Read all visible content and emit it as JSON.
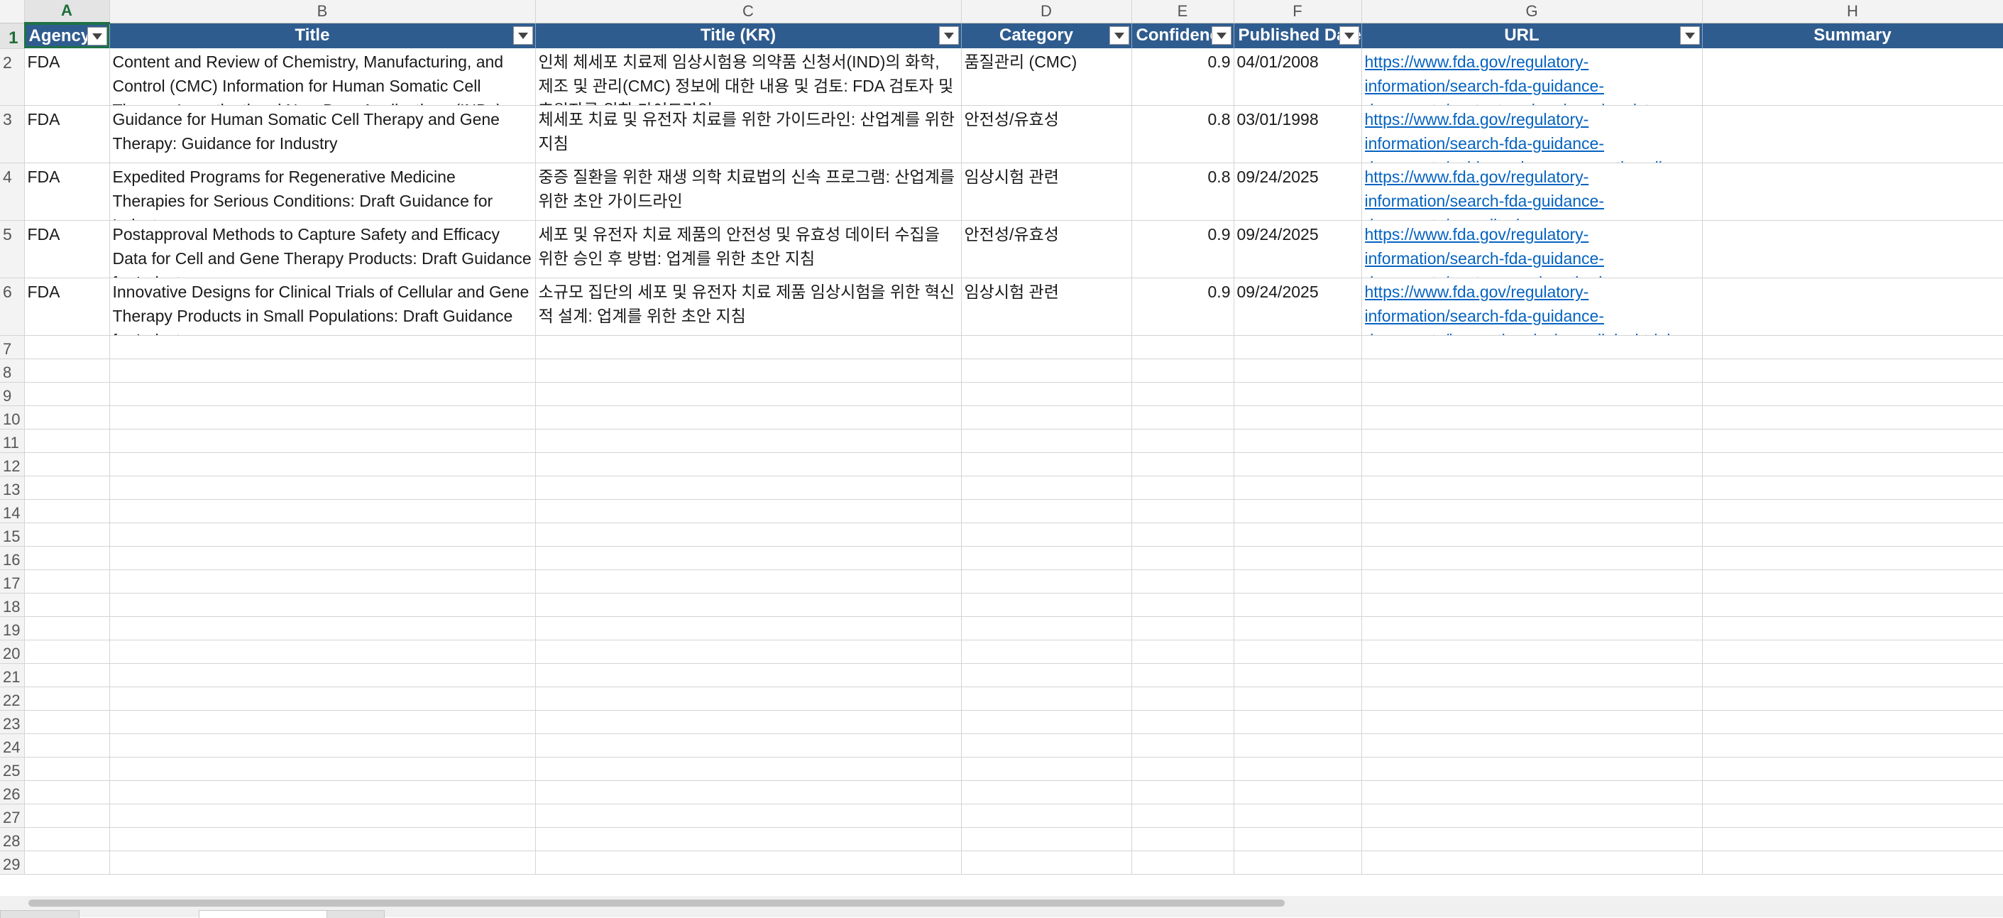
{
  "columns": [
    "A",
    "B",
    "C",
    "D",
    "E",
    "F",
    "G",
    "H"
  ],
  "headers": [
    "Agency",
    "Title",
    "Title (KR)",
    "Category",
    "Confidence",
    "Published Date",
    "URL",
    "Summary"
  ],
  "header_has_filter": [
    true,
    true,
    true,
    true,
    true,
    true,
    true,
    false
  ],
  "rows": [
    {
      "num": "2",
      "agency": "FDA",
      "title": "Content and Review of Chemistry, Manufacturing, and Control (CMC) Information for Human Somatic Cell Therapy Investigational New Drug Applications (INDs)",
      "title_kr": "인체 체세포 치료제 임상시험용 의약품 신청서(IND)의 화학, 제조 및 관리(CMC) 정보에 대한 내용 및 검토: FDA 검토자 및 후원자를 위한 가이드라인",
      "category": "품질관리 (CMC)",
      "confidence": "0.9",
      "date": "04/01/2008",
      "url": "https://www.fda.gov/regulatory-information/search-fda-guidance-documents/content-and-review-chemistry",
      "summary": ""
    },
    {
      "num": "3",
      "agency": "FDA",
      "title": "Guidance for Human Somatic Cell Therapy and Gene Therapy:  Guidance for Industry",
      "title_kr": "체세포 치료 및 유전자 치료를 위한 가이드라인: 산업계를 위한 지침",
      "category": "안전성/유효성",
      "confidence": "0.8",
      "date": "03/01/1998",
      "url": "https://www.fda.gov/regulatory-information/search-fda-guidance-documents/guidance-human-somatic-cell",
      "summary": ""
    },
    {
      "num": "4",
      "agency": "FDA",
      "title": "Expedited Programs for Regenerative Medicine Therapies for Serious Conditions: Draft Guidance for Industry",
      "title_kr": "중증 질환을 위한 재생 의학 치료법의 신속 프로그램: 산업계를 위한 초안 가이드라인",
      "category": "임상시험 관련",
      "confidence": "0.8",
      "date": "09/24/2025",
      "url": "https://www.fda.gov/regulatory-information/search-fda-guidance-documents/expedited-programs",
      "summary": ""
    },
    {
      "num": "5",
      "agency": "FDA",
      "title": "Postapproval Methods to Capture Safety and Efficacy Data for Cell and Gene Therapy Products: Draft Guidance for Industry",
      "title_kr": "세포 및 유전자 치료 제품의 안전성 및 유효성 데이터 수집을 위한 승인 후 방법: 업계를 위한 초안 지침",
      "category": "안전성/유효성",
      "confidence": "0.9",
      "date": "09/24/2025",
      "url": "https://www.fda.gov/regulatory-information/search-fda-guidance-documents/postapproval-methods",
      "summary": ""
    },
    {
      "num": "6",
      "agency": "FDA",
      "title": "Innovative Designs for Clinical Trials of Cellular and Gene Therapy Products in Small Populations: Draft Guidance for Industry",
      "title_kr": "소규모 집단의 세포 및 유전자 치료 제품 임상시험을 위한 혁신적 설계: 업계를 위한 초안 지침",
      "category": "임상시험 관련",
      "confidence": "0.9",
      "date": "09/24/2025",
      "url": "https://www.fda.gov/regulatory-information/search-fda-guidance-documents/innovative-designs-clinical-trials",
      "summary": ""
    }
  ],
  "empty_rows": [
    "7",
    "8",
    "9",
    "10",
    "11",
    "12",
    "13",
    "14",
    "15",
    "16",
    "17",
    "18",
    "19",
    "20",
    "21",
    "22",
    "23",
    "24",
    "25",
    "26",
    "27",
    "28",
    "29"
  ]
}
